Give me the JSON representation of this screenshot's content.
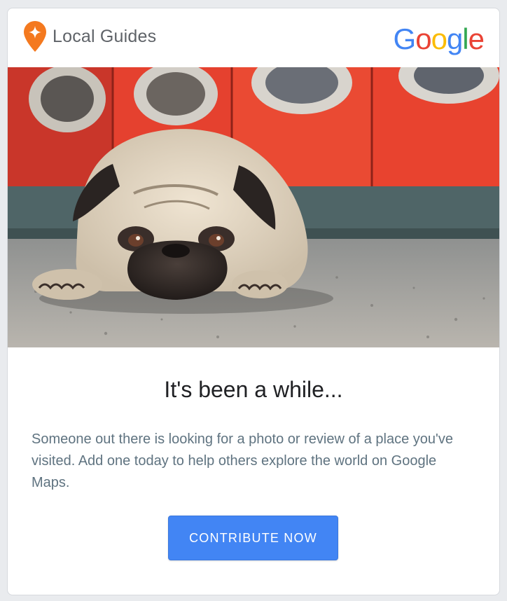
{
  "header": {
    "brand_name": "Local Guides",
    "partner_logo": {
      "letters": [
        "G",
        "o",
        "o",
        "g",
        "l",
        "e"
      ],
      "colors": [
        "#4285F4",
        "#EA4335",
        "#FBBC05",
        "#4285F4",
        "#34A853",
        "#EA4335"
      ]
    },
    "brand_icon": "local-guides-pin-icon",
    "brand_color": "#F4791F"
  },
  "hero_image": {
    "description_icon": "pug-photo"
  },
  "content": {
    "headline": "It's been a while...",
    "body": "Someone out there is looking for a photo or review of a place you've visited. Add one today to help others explore the world on Google Maps.",
    "cta_label": "CONTRIBUTE NOW"
  },
  "colors": {
    "cta_background": "#4285F4",
    "headline": "#202124",
    "body_text": "#5F7380"
  }
}
